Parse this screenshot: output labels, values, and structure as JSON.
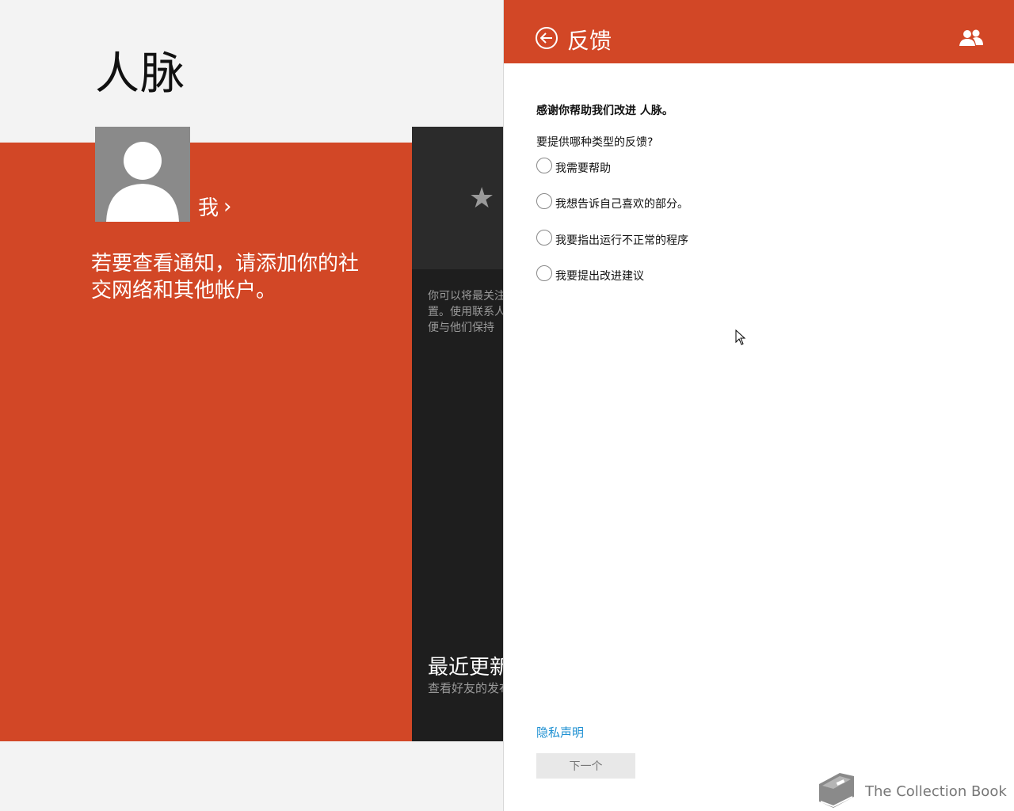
{
  "app": {
    "title": "人脉"
  },
  "me": {
    "label": "我",
    "chevron": "›"
  },
  "notice": "若要查看通知，请添加你的社交网络和其他帐户。",
  "favorites": {
    "icon": "star-icon",
    "text": "你可以将最关注的人放在特殊位置。使用联系人添加到收藏夹以便与他们保持"
  },
  "recent": {
    "title": "最近更新",
    "subtitle": "查看好友的发布"
  },
  "flyout": {
    "title": "反馈",
    "intro": "感谢你帮助我们改进 人脉。",
    "question": "要提供哪种类型的反馈?",
    "options": [
      {
        "label": "我需要帮助"
      },
      {
        "label": "我想告诉自己喜欢的部分。"
      },
      {
        "label": "我要指出运行不正常的程序"
      },
      {
        "label": "我要提出改进建议"
      }
    ],
    "privacy_link": "隐私声明",
    "next_button": "下一个"
  },
  "watermark": {
    "text": "The Collection Book"
  },
  "colors": {
    "accent": "#d24726",
    "dark_tile": "#2b2b2b",
    "dark_panel": "#1e1e1e",
    "link": "#1e90d2",
    "background": "#f3f3f3"
  }
}
